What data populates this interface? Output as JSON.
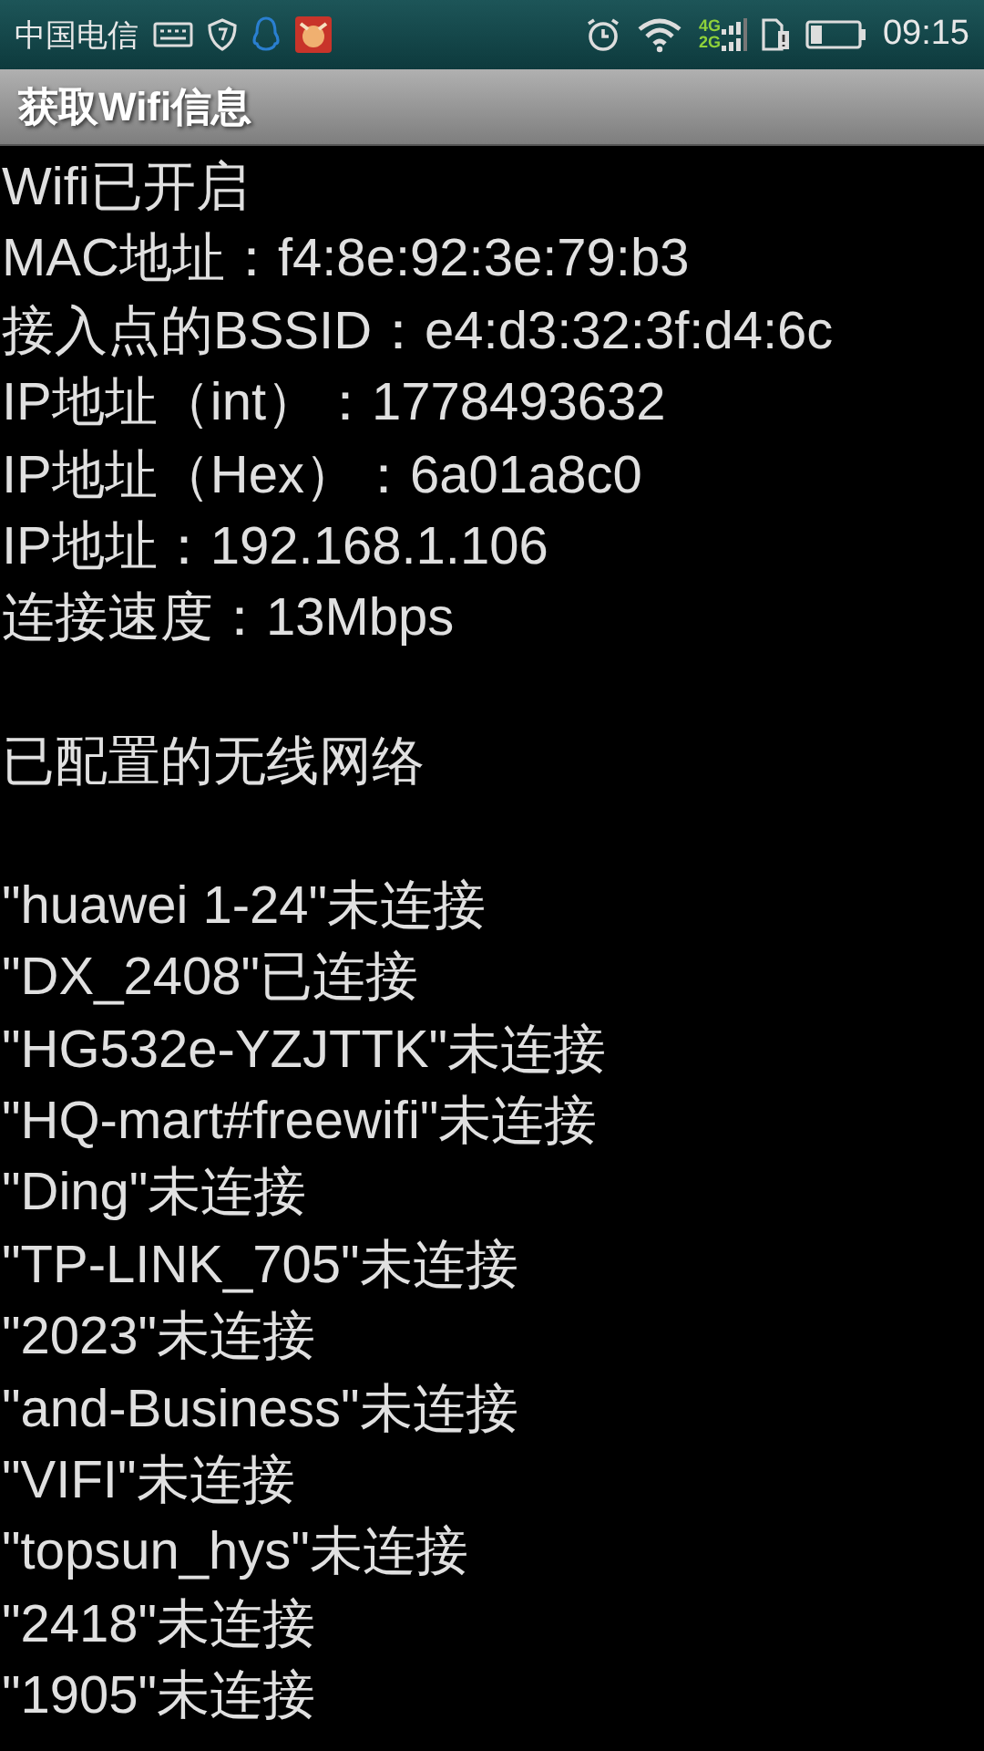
{
  "status_bar": {
    "carrier": "中国电信",
    "network_labels": [
      "4G",
      "2G"
    ],
    "time": "09:15"
  },
  "title_bar": {
    "title": "获取Wifi信息"
  },
  "wifi_info": [
    "Wifi已开启",
    "MAC地址：f4:8e:92:3e:79:b3",
    "接入点的BSSID：e4:d3:32:3f:d4:6c",
    "IP地址（int）：1778493632",
    "IP地址（Hex）：6a01a8c0",
    "IP地址：192.168.1.106",
    "连接速度：13Mbps"
  ],
  "configured_networks": {
    "heading": "已配置的无线网络",
    "items": [
      {
        "text": "\"huawei 1-24\"未连接"
      },
      {
        "text": "\"DX_2408\"已连接"
      },
      {
        "text": "\"HG532e-YZJTTK\"未连接"
      },
      {
        "text": "\"HQ-mart#freewifi\"未连接"
      },
      {
        "text": "\"Ding\"未连接"
      },
      {
        "text": "\"TP-LINK_705\"未连接"
      },
      {
        "text": "\"2023\"未连接"
      },
      {
        "text": "\"and-Business\"未连接"
      },
      {
        "text": "\"VIFI\"未连接"
      },
      {
        "text": "\"topsun_hys\"未连接"
      },
      {
        "text": "\"2418\"未连接"
      },
      {
        "text": "\"1905\"未连接"
      }
    ]
  }
}
